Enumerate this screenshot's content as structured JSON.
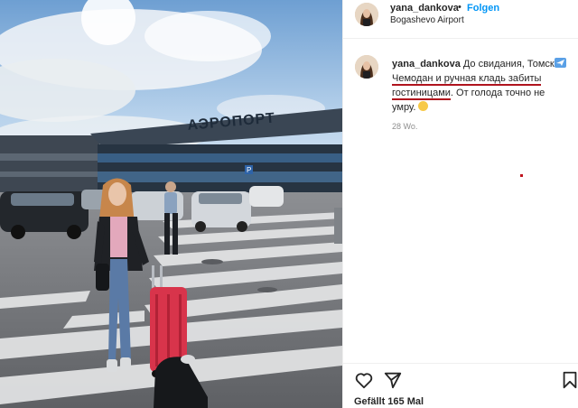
{
  "post": {
    "username": "yana_dankova",
    "separator": "•",
    "follow_label": "Folgen",
    "location": "Bogashevo Airport",
    "photo_sign_text": "АЭРОПОРТ",
    "caption": {
      "username": "yana_dankova",
      "line1": "До свидания, Томск",
      "line2_underlined": "Чемодан и ручная кладь забиты",
      "line3_underlined": "гостиницами",
      "line3_rest": ". От голода точно не умру.",
      "underline_color": "#b0141e"
    },
    "timestamp": "28 Wo.",
    "likes": "Gefällt 165 Mal"
  },
  "icons": {
    "heart": "heart-icon",
    "share": "share-icon",
    "bookmark": "bookmark-icon",
    "plane": "airplane-emoji",
    "smile": "smile-emoji"
  },
  "colors": {
    "follow": "#0095f6",
    "muted": "#8e8e8e",
    "text": "#262626"
  }
}
